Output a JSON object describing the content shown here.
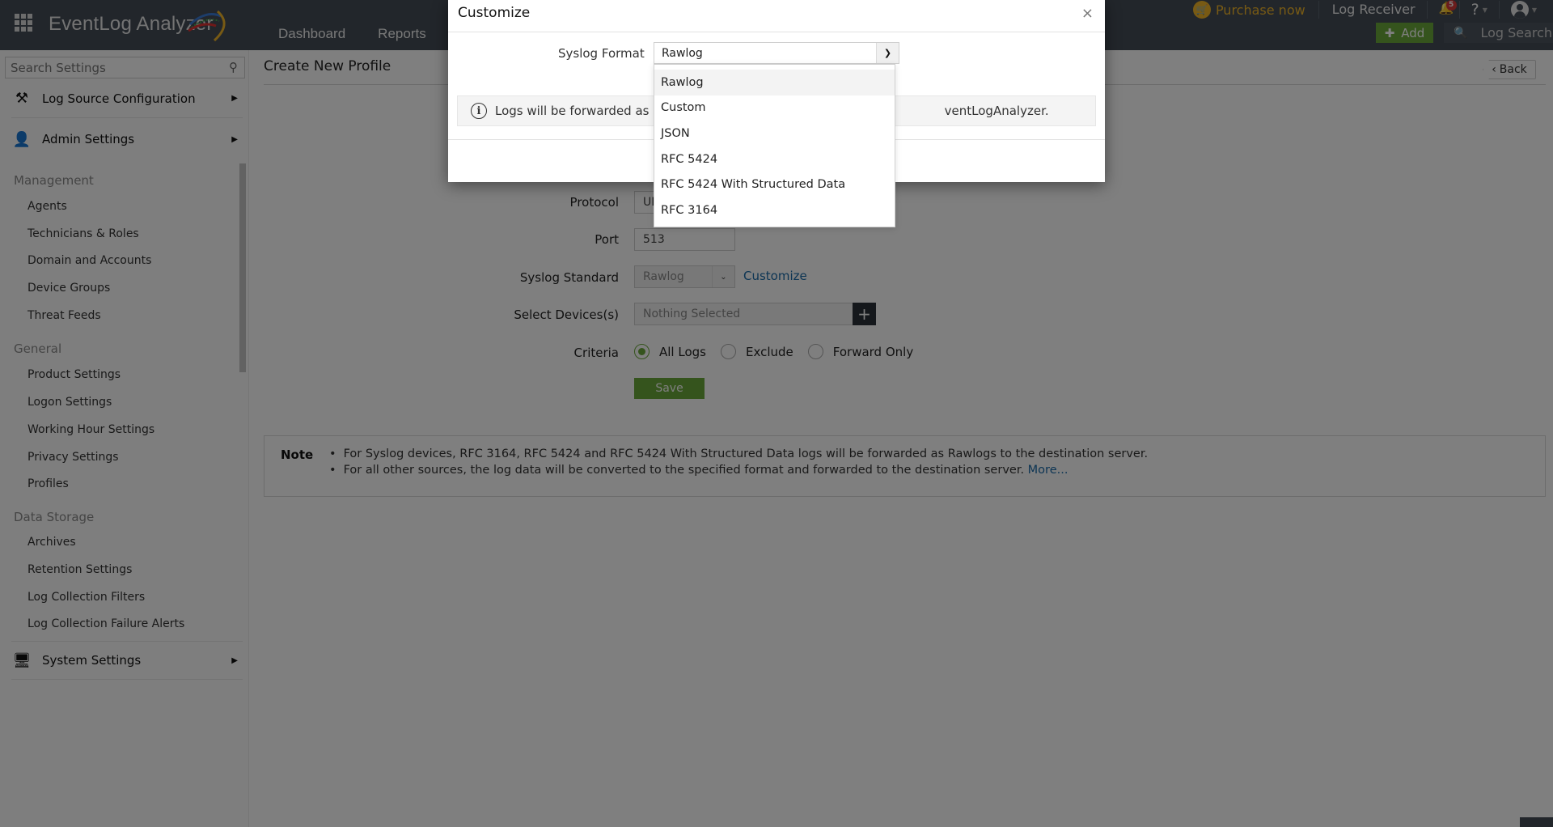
{
  "header": {
    "app_name": "EventLog Analyzer",
    "nav": [
      "Dashboard",
      "Reports"
    ],
    "purchase_label": "Purchase now",
    "log_receiver_label": "Log Receiver",
    "notification_count": "5",
    "help_label": "?",
    "add_label": "Add",
    "log_search_label": "Log Search",
    "icons": {
      "apps": "apps-grid-icon",
      "cart": "cart-icon",
      "bell": "bell-icon",
      "user": "user-icon",
      "plus": "plus-icon",
      "search": "search-icon"
    }
  },
  "sidebar": {
    "search_placeholder": "Search Settings",
    "categories": [
      {
        "label": "Log Source Configuration",
        "icon": "tools-icon"
      },
      {
        "label": "Admin Settings",
        "icon": "admin-gear-icon"
      },
      {
        "label": "System Settings",
        "icon": "monitor-gear-icon"
      }
    ],
    "groups": [
      {
        "title": "Management",
        "items": [
          "Agents",
          "Technicians & Roles",
          "Domain and Accounts",
          "Device Groups",
          "Threat Feeds"
        ]
      },
      {
        "title": "General",
        "items": [
          "Product Settings",
          "Logon Settings",
          "Working Hour Settings",
          "Privacy Settings",
          "Profiles"
        ]
      },
      {
        "title": "Data Storage",
        "items": [
          "Archives",
          "Retention Settings",
          "Log Collection Filters",
          "Log Collection Failure Alerts"
        ]
      }
    ]
  },
  "main": {
    "page_title": "Create New Profile",
    "back_label": "Back",
    "form": {
      "protocol_label": "Protocol",
      "protocol_value": "UDP",
      "port_label": "Port",
      "port_value": "513",
      "syslog_standard_label": "Syslog Standard",
      "syslog_standard_value": "Rawlog",
      "customize_label": "Customize",
      "devices_label": "Select Devices(s)",
      "devices_placeholder": "Nothing Selected",
      "criteria_label": "Criteria",
      "criteria_options": [
        "All Logs",
        "Exclude",
        "Forward Only"
      ],
      "criteria_selected": "All Logs",
      "save_label": "Save"
    },
    "note": {
      "title": "Note",
      "lines": [
        "For Syslog devices, RFC 3164, RFC 5424 and RFC 5424 With Structured Data logs will be forwarded as Rawlogs to the destination server.",
        "For all other sources, the log data will be converted to the specified format and forwarded to the destination server."
      ],
      "more_link": "More..."
    }
  },
  "modal": {
    "title": "Customize",
    "close_label": "×",
    "syslog_format_label": "Syslog Format",
    "syslog_format_value": "Rawlog",
    "info_text_left": "Logs will be forwarded as R",
    "info_text_right": "ventLogAnalyzer.",
    "dropdown_options": [
      "Rawlog",
      "Custom",
      "JSON",
      "RFC 5424",
      "RFC 5424 With Structured Data",
      "RFC 3164"
    ],
    "dropdown_highlighted": "Rawlog"
  },
  "colors": {
    "accent_green": "#6aa83a",
    "link_blue": "#1a6aa8",
    "purchase_gold": "#f0b429",
    "topbar_bg": "#444d57",
    "badge_red": "#d63b3b"
  }
}
